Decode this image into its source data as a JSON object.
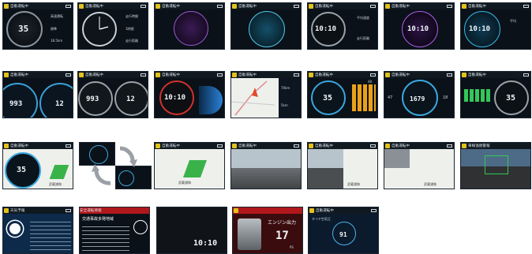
{
  "status_bar": {
    "title": "自動運転中",
    "camera_icon": "camera-icon",
    "battery_icon": "battery-icon"
  },
  "row1": {
    "t1": {
      "speed": "35",
      "right_top": "高速運転",
      "right_mid": "標準",
      "right_bot": "18.5km"
    },
    "t2": {
      "right_top": "走行時間",
      "right_mid": "1時間",
      "right_bot": "走行距離"
    },
    "t3": {},
    "t4": {},
    "t5": {
      "time": "10:10",
      "right_top": "平均速度",
      "right_bot": "走行距離"
    },
    "t6": {
      "time": "10:10"
    },
    "t7": {
      "time": "10:10",
      "right_top": "平均"
    }
  },
  "row2": {
    "t1": {
      "left_val": "993",
      "right_val": "12"
    },
    "t2": {
      "left_val": "993",
      "right_val": "12"
    },
    "t3": {
      "time": "10:10"
    },
    "t4": {
      "right_a": "70km",
      "right_b": "5km"
    },
    "t5": {
      "speed": "35",
      "side": "48"
    },
    "t6": {
      "value": "1679",
      "left": "47",
      "right": "18"
    },
    "t7": {
      "speed": "35"
    }
  },
  "row3": {
    "t1": {
      "speed": "35",
      "place": "武蔵浦和"
    },
    "t3": {
      "place": "武蔵浦和"
    },
    "t5": {
      "place": "武蔵浦和"
    },
    "t6": {
      "place": "武蔵浦和"
    },
    "t7": {
      "title": "車線逸脱警報"
    }
  },
  "row4": {
    "t1": {
      "title": "天気予報"
    },
    "t2": {
      "title": "安全運転情報",
      "sub": "交通事故多発地域"
    },
    "t3": {
      "time": "10:10"
    },
    "t4": {
      "title": "エンジン出力",
      "value": "17",
      "unit": "PS"
    },
    "t5": {
      "value": "91",
      "left": "タイヤ空気圧"
    }
  },
  "colors": {
    "accent_blue": "#2a9fe0",
    "accent_green": "#34c759",
    "alert_red": "#c81d22",
    "tile_bg": "#0b1118"
  }
}
